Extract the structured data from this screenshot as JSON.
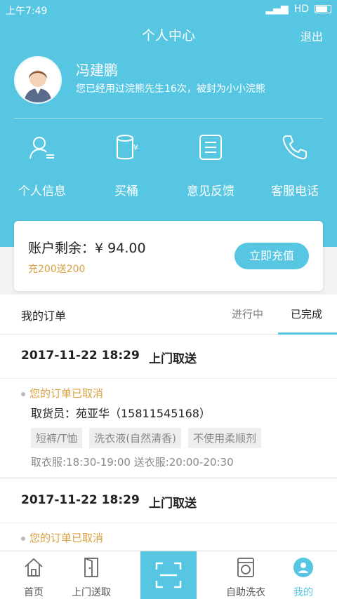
{
  "status_bar": {
    "time": "上午7:49",
    "network": "HD"
  },
  "header": {
    "title": "个人中心",
    "logout_label": "退出"
  },
  "profile": {
    "name": "冯建鹏",
    "description": "您已经用过浣熊先生16次，被封为小小浣熊"
  },
  "quick_actions": [
    {
      "label": "个人信息",
      "icon": "user-info-icon"
    },
    {
      "label": "买桶",
      "icon": "bucket-yen-icon"
    },
    {
      "label": "意见反馈",
      "icon": "feedback-icon"
    },
    {
      "label": "客服电话",
      "icon": "phone-icon"
    }
  ],
  "account": {
    "balance_label": "账户剩余：",
    "balance_value": "¥ 94.00",
    "promo": "充200送200",
    "recharge_label": "立即充值"
  },
  "orders_section": {
    "title": "我的订单",
    "tabs": [
      {
        "label": "进行中",
        "active": false
      },
      {
        "label": "已完成",
        "active": true
      }
    ]
  },
  "orders": [
    {
      "datetime": "2017-11-22 18:29",
      "type": "上门取送",
      "status": "您的订单已取消",
      "courier": "取货员：苑亚华（15811545168）",
      "tags": [
        "短裤/T恤",
        "洗衣液(自然清香)",
        "不使用柔顺剂"
      ],
      "times": "取衣服:18:30-19:00 送衣服:20:00-20:30"
    },
    {
      "datetime": "2017-11-22 18:29",
      "type": "上门取送",
      "status": "您的订单已取消"
    }
  ],
  "bottom_nav": [
    {
      "label": "首页",
      "icon": "home-icon"
    },
    {
      "label": "上门送取",
      "icon": "door-icon"
    },
    {
      "label": "",
      "icon": "scan-icon"
    },
    {
      "label": "自助洗衣",
      "icon": "washer-icon"
    },
    {
      "label": "我的",
      "icon": "profile-icon"
    }
  ],
  "colors": {
    "accent": "#56c6e3",
    "promo": "#d8a041"
  }
}
